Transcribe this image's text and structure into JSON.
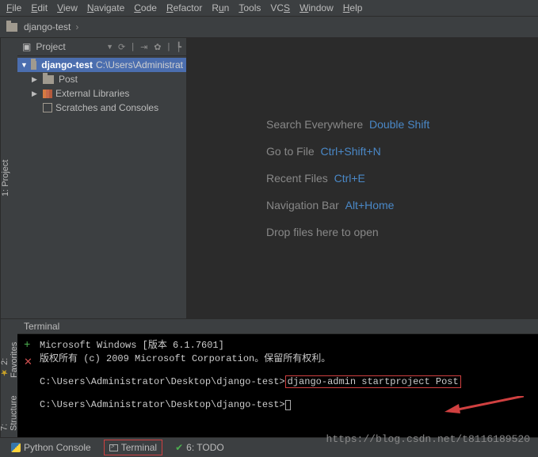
{
  "menubar": [
    "File",
    "Edit",
    "View",
    "Navigate",
    "Code",
    "Refactor",
    "Run",
    "Tools",
    "VCS",
    "Window",
    "Help"
  ],
  "breadcrumb": {
    "project": "django-test"
  },
  "sidebar": {
    "header": {
      "title": "Project"
    },
    "root": {
      "name": "django-test",
      "path": "C:\\Users\\Administrat"
    },
    "items": [
      {
        "name": "Post"
      },
      {
        "name": "External Libraries"
      },
      {
        "name": "Scratches and Consoles"
      }
    ]
  },
  "left_tabs": {
    "project": "1: Project"
  },
  "left_tabs2": {
    "favorites": "2: Favorites",
    "structure": "7: Structure"
  },
  "editor_tips": [
    {
      "label": "Search Everywhere",
      "shortcut": "Double Shift"
    },
    {
      "label": "Go to File",
      "shortcut": "Ctrl+Shift+N"
    },
    {
      "label": "Recent Files",
      "shortcut": "Ctrl+E"
    },
    {
      "label": "Navigation Bar",
      "shortcut": "Alt+Home"
    },
    {
      "label": "Drop files here to open",
      "shortcut": ""
    }
  ],
  "terminal": {
    "title": "Terminal",
    "lines": {
      "l1": "Microsoft Windows [版本 6.1.7601]",
      "l2": "版权所有 (c) 2009 Microsoft Corporation。保留所有权利。",
      "prompt1": "C:\\Users\\Administrator\\Desktop\\django-test>",
      "cmd": "django-admin startproject Post",
      "prompt2": "C:\\Users\\Administrator\\Desktop\\django-test>"
    }
  },
  "bottom": {
    "python_console": "Python Console",
    "terminal": "Terminal",
    "todo": "6: TODO"
  },
  "watermark": "https://blog.csdn.net/t8116189520"
}
